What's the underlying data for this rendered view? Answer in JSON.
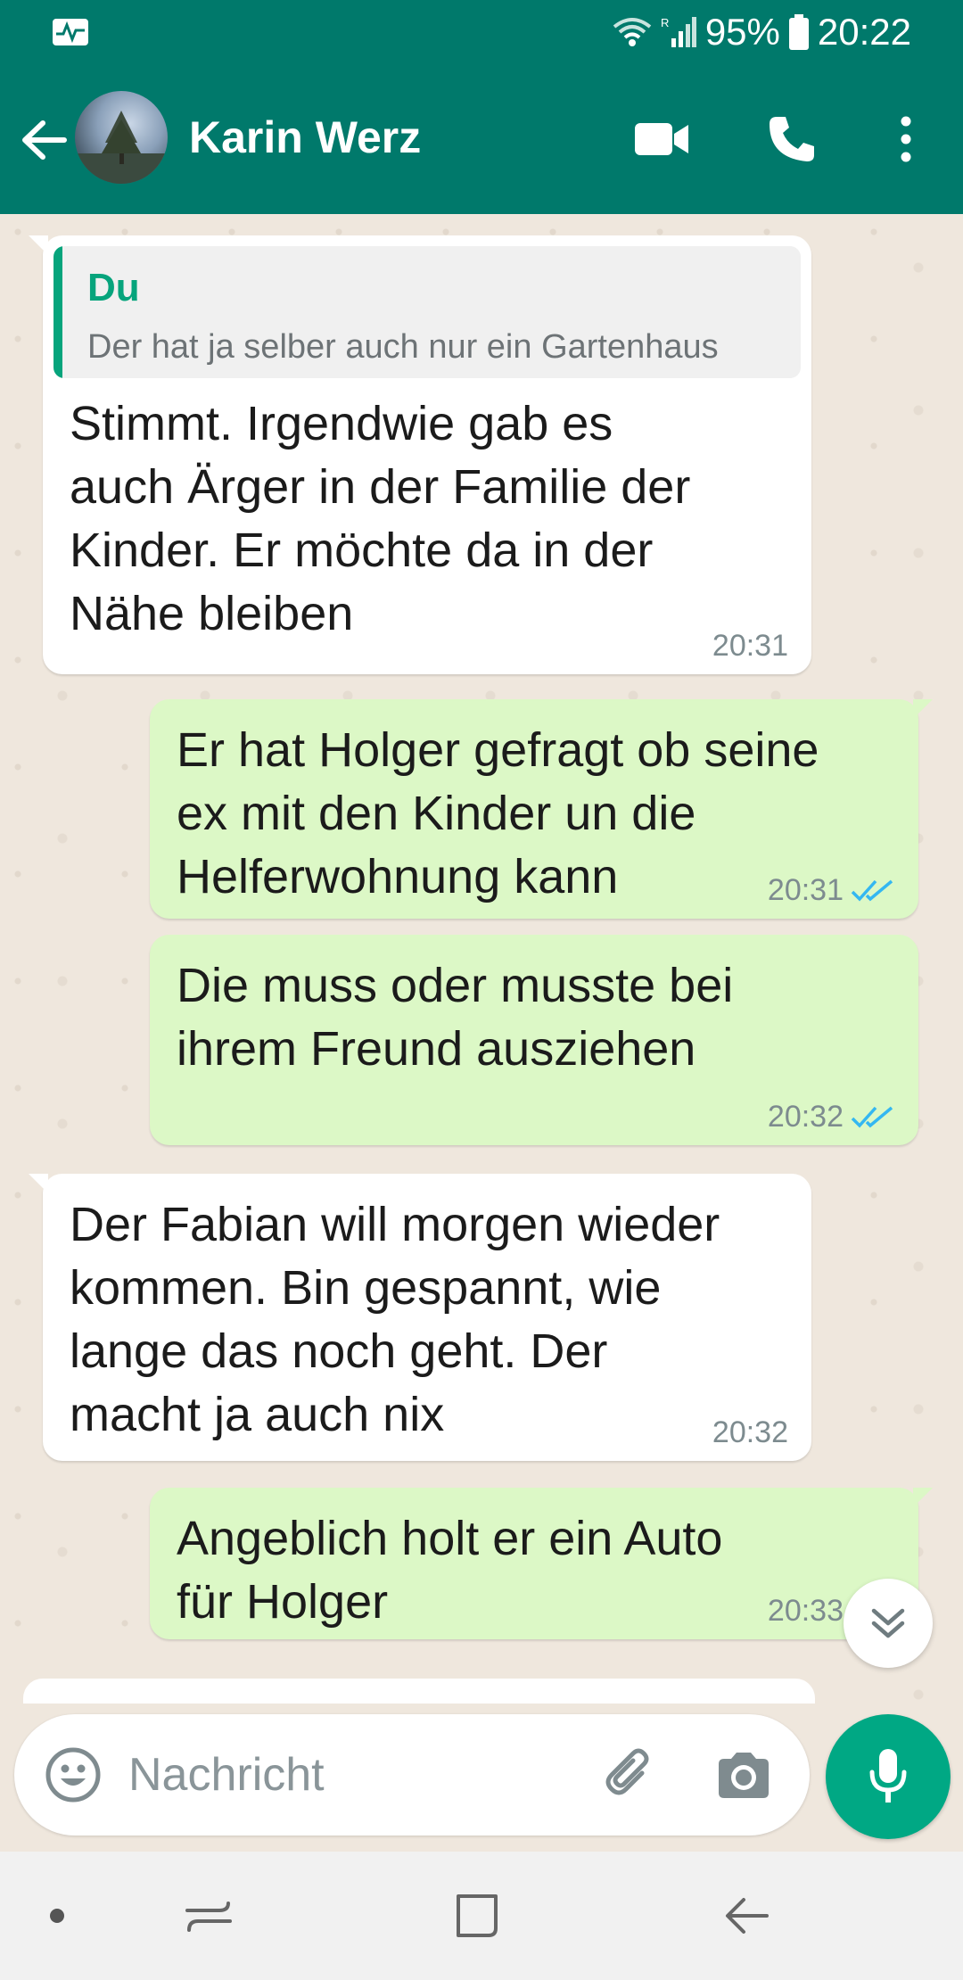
{
  "status_bar": {
    "battery_percent": "95%",
    "time": "20:22"
  },
  "header": {
    "contact_name": "Karin Werz"
  },
  "messages": [
    {
      "direction": "in",
      "quote_author": "Du",
      "quote_text": "Der hat ja selber auch nur ein Gartenhaus",
      "text": "Stimmt. Irgendwie gab es\nauch Ärger in der Familie der\nKinder. Er möchte da in der\nNähe bleiben",
      "time": "20:31"
    },
    {
      "direction": "out",
      "text": "Er hat Holger gefragt ob seine\nex mit den Kinder un die\nHelferwohnung kann",
      "time": "20:31",
      "read": true
    },
    {
      "direction": "out",
      "text": "Die muss oder musste bei\nihrem Freund ausziehen",
      "time": "20:32",
      "read": true
    },
    {
      "direction": "in",
      "text": "Der Fabian will morgen wieder\nkommen. Bin gespannt, wie\nlange das noch geht. Der\nmacht ja auch nix",
      "time": "20:32"
    },
    {
      "direction": "out",
      "text": "Angeblich holt er ein Auto\nfür Holger",
      "time": "20:33",
      "read": true
    }
  ],
  "input": {
    "placeholder": "Nachricht"
  },
  "colors": {
    "primary": "#00796b",
    "accent": "#00a884",
    "outgoing_bubble": "#dcf8c6",
    "incoming_bubble": "#ffffff",
    "chat_background": "#efe7dd",
    "read_ticks": "#34b7f1"
  }
}
